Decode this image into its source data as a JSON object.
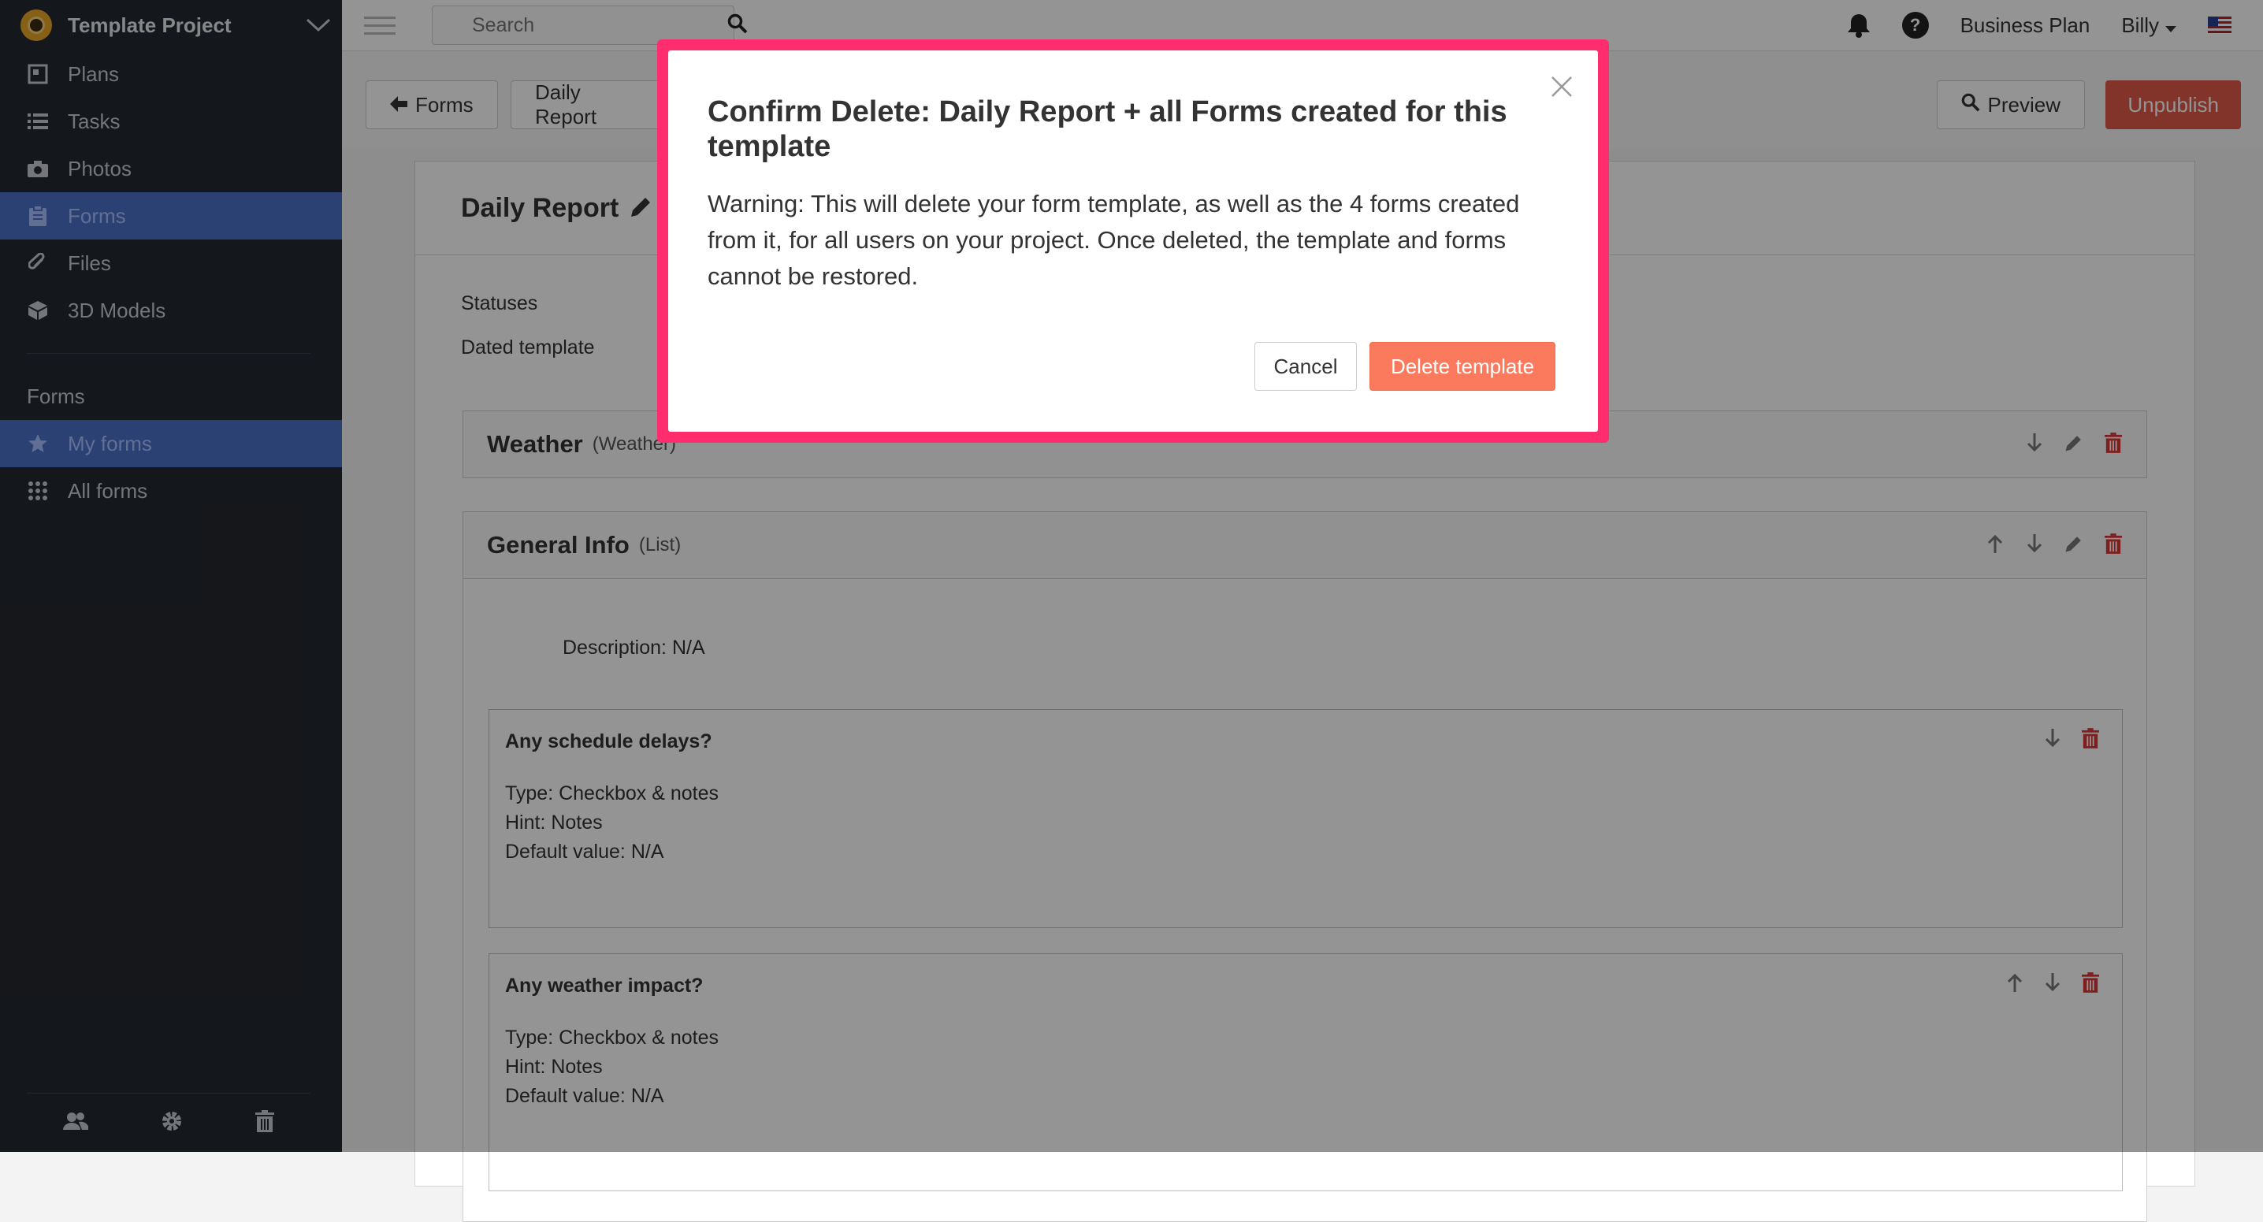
{
  "app": {
    "project_title": "Template Project"
  },
  "sidebar": {
    "items": [
      {
        "label": "Plans",
        "icon": "plans-icon"
      },
      {
        "label": "Tasks",
        "icon": "list-icon"
      },
      {
        "label": "Photos",
        "icon": "camera-icon"
      },
      {
        "label": "Forms",
        "icon": "clipboard-icon"
      },
      {
        "label": "Files",
        "icon": "paperclip-icon"
      },
      {
        "label": "3D Models",
        "icon": "cube-icon"
      }
    ],
    "section_label": "Forms",
    "form_items": [
      {
        "label": "My forms",
        "icon": "star-icon"
      },
      {
        "label": "All forms",
        "icon": "grid-icon"
      }
    ],
    "footer_icons": [
      "users-icon",
      "gear-icon",
      "trash-icon"
    ]
  },
  "topbar": {
    "search_placeholder": "Search",
    "plan_label": "Business Plan",
    "user_label": "Billy",
    "help_glyph": "?"
  },
  "subbar": {
    "back_label": "Forms",
    "breadcrumb_label": "Daily Report",
    "preview_label": "Preview",
    "unpublish_label": "Unpublish"
  },
  "template": {
    "title": "Daily Report",
    "statuses_label": "Statuses",
    "dated_label": "Dated template",
    "sections": [
      {
        "title": "Weather",
        "type": "(Weather)"
      },
      {
        "title": "General Info",
        "type": "(List)",
        "description": "Description: N/A"
      }
    ],
    "fields": [
      {
        "title": "Any schedule delays?",
        "type": "Type: Checkbox & notes",
        "hint": "Hint: Notes",
        "default": "Default value: N/A"
      },
      {
        "title": "Any weather impact?",
        "type": "Type: Checkbox & notes",
        "hint": "Hint: Notes",
        "default": "Default value: N/A"
      }
    ]
  },
  "modal": {
    "title": "Confirm Delete: Daily Report + all Forms created for this template",
    "body": "Warning: This will delete your form template, as well as the 4 forms created from it, for all users on your project. Once deleted, the template and forms cannot be restored.",
    "cancel_label": "Cancel",
    "delete_label": "Delete template"
  },
  "colors": {
    "sidebar_bg": "#24282f",
    "active_item": "#4a6fc7",
    "danger": "#e05a4a",
    "delete_button": "#fb7a5e",
    "modal_highlight": "#ff2c6e"
  }
}
